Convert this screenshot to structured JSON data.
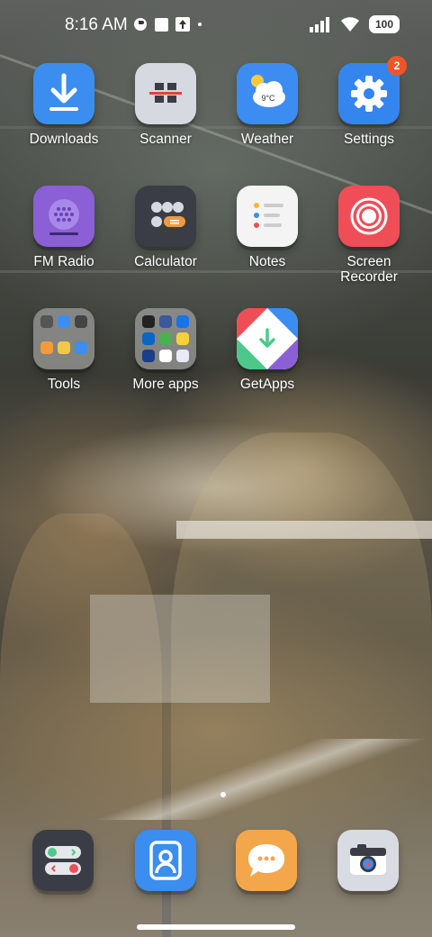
{
  "status_bar": {
    "time": "8:16 AM",
    "battery": "100",
    "icons": [
      "notification-icon",
      "square-icon",
      "upload-icon",
      "dot-icon",
      "signal-icon",
      "wifi-icon",
      "battery-icon"
    ]
  },
  "apps": [
    {
      "label": "Downloads",
      "icon": "download-icon"
    },
    {
      "label": "Scanner",
      "icon": "scanner-icon"
    },
    {
      "label": "Weather",
      "icon": "weather-icon",
      "temp": "9°C"
    },
    {
      "label": "Settings",
      "icon": "gear-icon",
      "badge": "2"
    },
    {
      "label": "FM Radio",
      "icon": "radio-icon"
    },
    {
      "label": "Calculator",
      "icon": "calculator-icon"
    },
    {
      "label": "Notes",
      "icon": "notes-icon"
    },
    {
      "label": "Screen\nRecorder",
      "icon": "screen-recorder-icon"
    },
    {
      "label": "Tools",
      "icon": "folder-icon"
    },
    {
      "label": "More apps",
      "icon": "folder-icon"
    },
    {
      "label": "GetApps",
      "icon": "getapps-icon"
    }
  ],
  "dock": [
    {
      "name": "phone",
      "icon": "phone-icon"
    },
    {
      "name": "contacts",
      "icon": "contacts-icon"
    },
    {
      "name": "messages",
      "icon": "messages-icon"
    },
    {
      "name": "camera",
      "icon": "camera-icon"
    }
  ],
  "colors": {
    "downloads": "#3b8ef0",
    "scanner": "#d7d9e0",
    "weather": "#3d8cf2",
    "settings": "#3585ee",
    "fm_radio": "#8b5fd6",
    "calculator": "#3a3d45",
    "notes": "#f4f4f4",
    "screen_recorder": "#ef4e57",
    "contacts": "#3b8ef0",
    "messages": "#f3a64a",
    "camera": "#d9dbe2",
    "badge": "#f0552a"
  }
}
